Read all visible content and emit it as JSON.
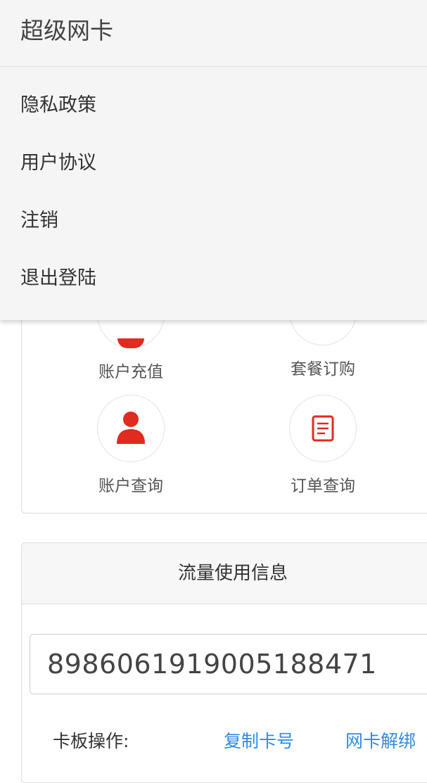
{
  "drawer": {
    "title": "超级网卡",
    "items": [
      {
        "label": "隐私政策"
      },
      {
        "label": "用户协议"
      },
      {
        "label": "注销"
      },
      {
        "label": "退出登陆"
      }
    ]
  },
  "functions": [
    {
      "label": "账户充值",
      "icon": "wallet-icon"
    },
    {
      "label": "套餐订购",
      "icon": "package-icon"
    },
    {
      "label": "账户查询",
      "icon": "person-icon"
    },
    {
      "label": "订单查询",
      "icon": "document-icon"
    }
  ],
  "flow_card": {
    "title": "流量使用信息",
    "card_number": "8986061919005188471",
    "ops_label": "卡板操作:",
    "ops": [
      {
        "label": "复制卡号"
      },
      {
        "label": "网卡解绑"
      }
    ]
  },
  "colors": {
    "accent_red": "#e02b20",
    "link_blue": "#2f8be6"
  }
}
